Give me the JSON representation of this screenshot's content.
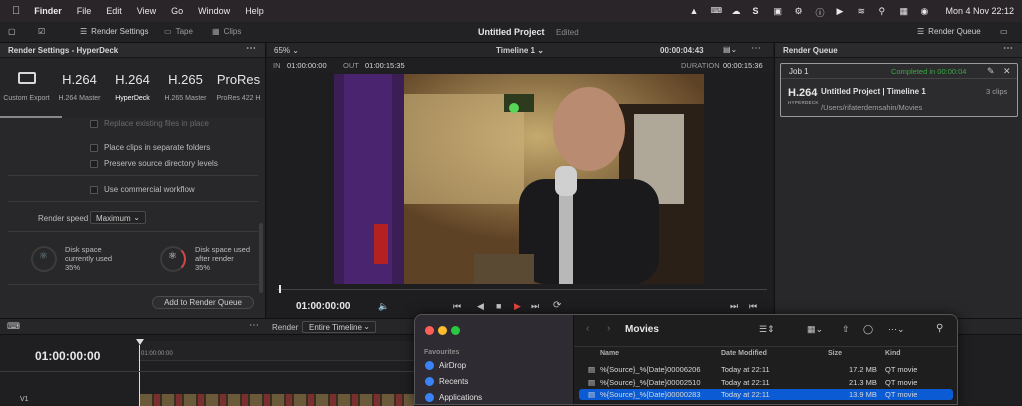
{
  "menubar": {
    "app": "Finder",
    "items": [
      "File",
      "Edit",
      "View",
      "Go",
      "Window",
      "Help"
    ],
    "clock": "Mon 4 Nov  22:12"
  },
  "toolbar": {
    "render_settings": "Render Settings",
    "tape": "Tape",
    "clips": "Clips",
    "project_title": "Untitled Project",
    "edited": "Edited",
    "render_queue": "Render Queue"
  },
  "render_settings": {
    "title": "Render Settings - HyperDeck",
    "presets": [
      {
        "big": "",
        "label": "Custom Export"
      },
      {
        "big": "H.264",
        "label": "H.264 Master"
      },
      {
        "big": "H.264",
        "label": "HyperDeck"
      },
      {
        "big": "H.265",
        "label": "H.265 Master"
      },
      {
        "big": "ProRes",
        "label": "ProRes 422 H"
      }
    ],
    "replace_label": "Replace existing files in place",
    "checks": [
      "Place clips in separate folders",
      "Preserve source directory levels",
      "Use commercial workflow"
    ],
    "render_speed_label": "Render speed",
    "render_speed_value": "Maximum",
    "disk1": [
      "Disk space",
      "currently used",
      "35%"
    ],
    "disk2": [
      "Disk space used",
      "after render",
      "35%"
    ],
    "add_button": "Add to Render Queue"
  },
  "viewer": {
    "zoom": "65%",
    "timeline": "Timeline 1",
    "tc_top": "00:00:04:43",
    "in_label": "IN",
    "in_tc": "01:00:00:00",
    "out_label": "OUT",
    "out_tc": "01:00:15:35",
    "duration_label": "DURATION",
    "duration_tc": "00:00:15:36",
    "current_tc": "01:00:00:00"
  },
  "render_queue": {
    "title": "Render Queue",
    "job": "Job 1",
    "status": "Completed in 00:00:04",
    "codec": "H.264",
    "codec_sub": "HYPERDECK",
    "project": "Untitled Project | Timeline 1",
    "clips": "3 clips",
    "path": "/Users/rifaterdemsahin/Movies"
  },
  "timeline": {
    "tc": "01:00:00:00",
    "render_label": "Render",
    "render_value": "Entire Timeline",
    "ruler_tc": "01:00:00:00"
  },
  "finder": {
    "title": "Movies",
    "sidebar_heading": "Favourites",
    "sidebar_items": [
      "AirDrop",
      "Recents",
      "Applications"
    ],
    "columns": [
      "Name",
      "Date Modified",
      "Size",
      "Kind"
    ],
    "rows": [
      {
        "name": "%{Source}_%{Date}00006206",
        "date": "Today at 22:11",
        "size": "17.2 MB",
        "kind": "QT movie"
      },
      {
        "name": "%{Source}_%{Date}00002510",
        "date": "Today at 22:11",
        "size": "21.3 MB",
        "kind": "QT movie"
      },
      {
        "name": "%{Source}_%{Date}00000283",
        "date": "Today at 22:11",
        "size": "13.9 MB",
        "kind": "QT movie"
      }
    ],
    "colors": {
      "selected": "#0a5bd4",
      "close": "#ff5f57",
      "min": "#febc2e",
      "max": "#28c840"
    }
  }
}
